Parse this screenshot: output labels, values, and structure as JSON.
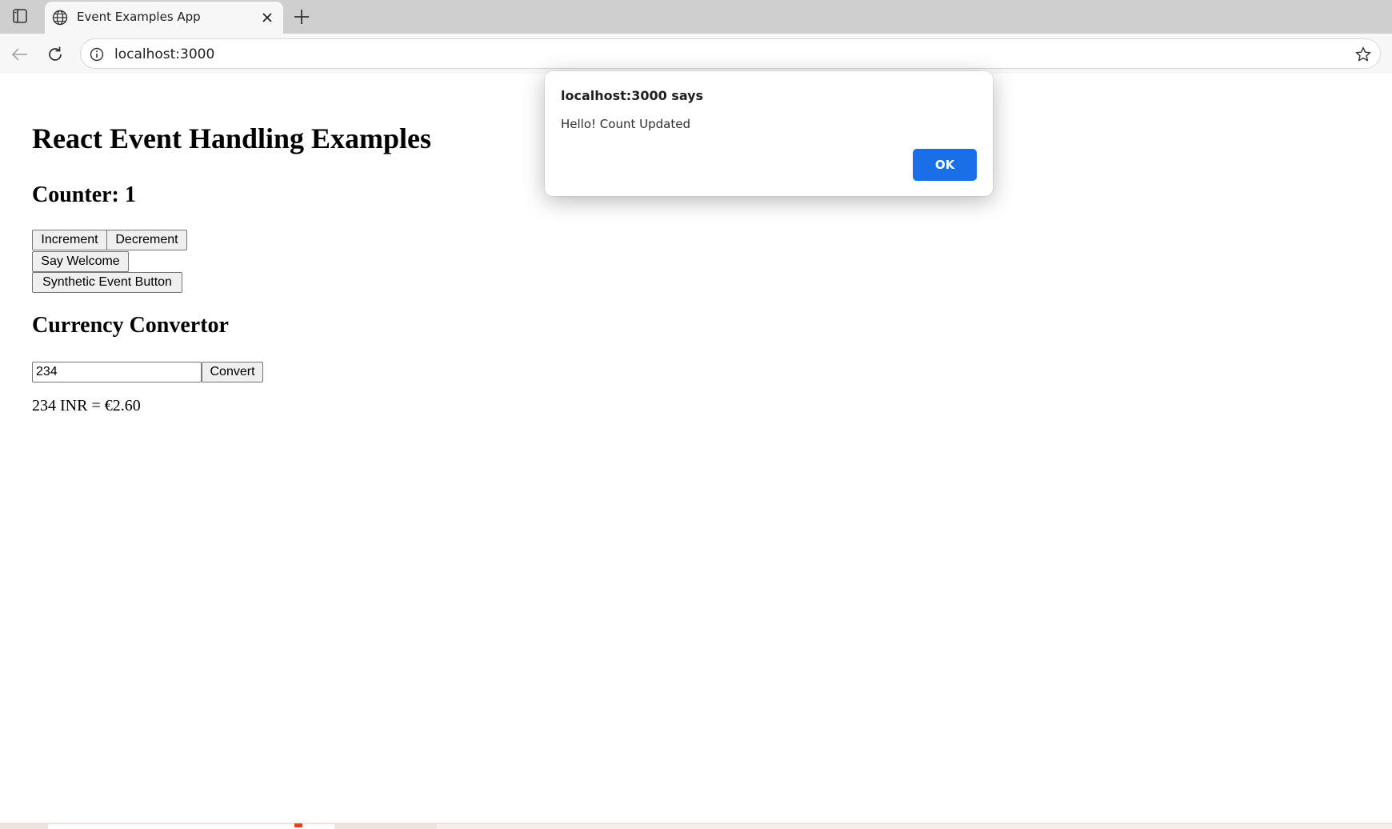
{
  "browser": {
    "tab_title": "Event Examples App",
    "url": "localhost:3000"
  },
  "page": {
    "heading": "React Event Handling Examples",
    "counter_heading": "Counter: 1",
    "buttons": {
      "increment": "Increment",
      "decrement": "Decrement",
      "say_welcome": "Say Welcome",
      "synthetic_event": "Synthetic Event Button"
    },
    "currency": {
      "heading": "Currency Convertor",
      "amount_value": "234",
      "convert_label": "Convert",
      "result": "234 INR = €2.60"
    }
  },
  "dialog": {
    "title": "localhost:3000 says",
    "message": "Hello! Count Updated",
    "ok_label": "OK"
  },
  "icons": {
    "sidebar": "sidebar-icon",
    "tab_favicon": "globe-icon",
    "tab_close": "close-icon",
    "new_tab": "plus-icon",
    "back": "arrow-left-icon",
    "reload": "reload-icon",
    "site_info": "info-icon",
    "bookmark": "star-icon"
  },
  "colors": {
    "dialog_ok_button": "#1a6ee8",
    "tab_strip": "#cfcfcf",
    "toolbar": "#f7f7f7"
  }
}
